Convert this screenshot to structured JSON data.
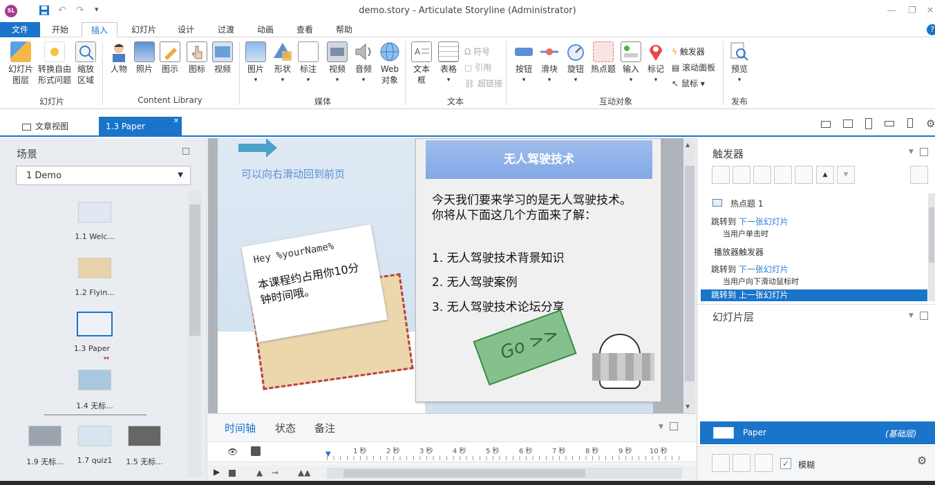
{
  "app": {
    "logo": "SL",
    "title": "demo.story  -  Articulate Storyline (Administrator)"
  },
  "qat": {
    "save": "save-icon",
    "undo": "↶",
    "redo": "↷",
    "more": "▾"
  },
  "menu": {
    "file": "文件",
    "tabs": [
      "开始",
      "插入",
      "幻灯片",
      "设计",
      "过渡",
      "动画",
      "查看",
      "帮助"
    ],
    "active": "插入"
  },
  "ribbon": {
    "slides_group": {
      "label": "幻灯片",
      "items": [
        "幻灯片\n图层",
        "转换自由\n形式问题",
        "缩放\n区域"
      ]
    },
    "library_group": {
      "label": "Content Library",
      "items": [
        "人物",
        "照片",
        "图示",
        "图标",
        "视频"
      ]
    },
    "media_insert": {
      "items": [
        "图片",
        "形状",
        "标注"
      ]
    },
    "media_group": {
      "label": "媒体",
      "items": [
        "视频",
        "音频",
        "Web\n对象"
      ]
    },
    "text_group": {
      "label": "文本",
      "items": [
        "文本\n框",
        "表格"
      ],
      "small": [
        "Ω 符号",
        "引用",
        "超链接"
      ]
    },
    "interactive_group": {
      "label": "互动对象",
      "items": [
        "按钮",
        "滑块",
        "旋钮",
        "热点题",
        "输入",
        "标记"
      ],
      "small": [
        "触发器",
        "滚动面板",
        "鼠标"
      ]
    },
    "publish_group": {
      "label": "发布",
      "items": [
        "预览"
      ]
    }
  },
  "doc_tabs": {
    "story_view": "文章视图",
    "active": "1.3 Paper"
  },
  "scenes": {
    "title": "场景",
    "dropdown": "1 Demo",
    "slides": [
      {
        "label": "1.1 Welc..."
      },
      {
        "label": "1.2 Flyin..."
      },
      {
        "label": "1.3 Paper"
      },
      {
        "label": "1.4 无标..."
      },
      {
        "label": "1.9 无标..."
      },
      {
        "label": "1.7 quiz1"
      },
      {
        "label": "1.5 无标..."
      }
    ]
  },
  "slide": {
    "swipe_hint": "可以向右滑动回到前页",
    "letter_greeting": "Hey %yourName%",
    "letter_text": "本课程约占用你10分钟时间哦。",
    "card_title": "无人驾驶技术",
    "card_intro": "今天我们要来学习的是无人驾驶技术。你将从下面这几个方面来了解：",
    "points": [
      "1. 无人驾驶技术背景知识",
      "2. 无人驾驶案例",
      "3. 无人驾驶技术论坛分享"
    ],
    "go_label": "Go >>"
  },
  "triggers": {
    "title": "触发器",
    "hotspot": "热点题 1",
    "rows": [
      {
        "action": "跳转到",
        "target": "下一张幻灯片",
        "cond": "当用户单击时"
      },
      {
        "section": "播放器触发器"
      },
      {
        "action": "跳转到",
        "target": "下一张幻灯片",
        "cond": "当用户向下滑动鼠标时"
      },
      {
        "action": "跳转到",
        "target": "上一张幻灯片"
      }
    ]
  },
  "layers": {
    "title": "幻灯片层",
    "base_name": "Paper",
    "base_tag": "(基础层)",
    "blur_label": "模糊"
  },
  "timeline": {
    "tabs": [
      "时间轴",
      "状态",
      "备注"
    ],
    "ticks": [
      "1 秒",
      "2 秒",
      "3 秒",
      "4 秒",
      "5 秒",
      "6 秒",
      "7 秒",
      "8 秒",
      "9 秒",
      "10 秒"
    ]
  },
  "colors": {
    "accent": "#1a74c9",
    "selected": "#1a74c9",
    "card_header": "#8fb2ea",
    "go": "#86c18d"
  }
}
